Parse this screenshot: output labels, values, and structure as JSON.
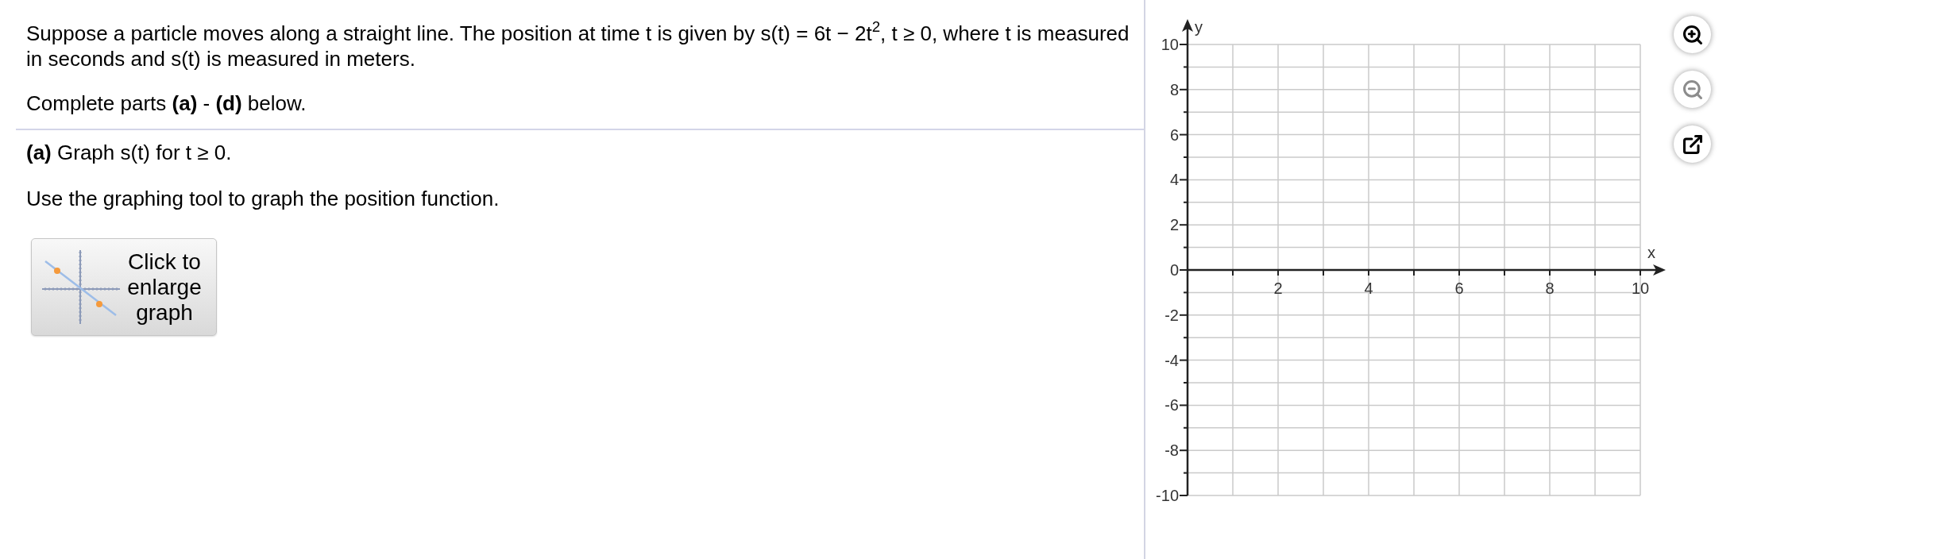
{
  "question": {
    "text": "Suppose a particle moves along a straight line. The position at time t is given by s(t) = 6t − 2t$^{2}$, t ≥ 0, where t is measured in seconds and s(t) is measured in meters.",
    "instruction": "Complete parts **(a)** - **(d)** below."
  },
  "part_a": {
    "prompt": "**(a)** Graph s(t) for t ≥ 0.",
    "instruction": "Use the graphing tool to graph the position function.",
    "enlarge_button": "Click to enlarge graph"
  },
  "graph": {
    "chart_data": {
      "type": "line",
      "xlabel": "x",
      "ylabel": "y",
      "xlim": [
        0,
        10
      ],
      "ylim": [
        -10,
        10
      ],
      "xticks": [
        2,
        4,
        6,
        8,
        10
      ],
      "yticks": [
        -10,
        -8,
        -6,
        -4,
        -2,
        0,
        2,
        4,
        6,
        8,
        10
      ],
      "grid": true
    },
    "tools": [
      {
        "kind": "zoom_in",
        "disabled": false
      },
      {
        "kind": "zoom_out",
        "disabled": true
      },
      {
        "kind": "popout",
        "disabled": false
      }
    ]
  }
}
